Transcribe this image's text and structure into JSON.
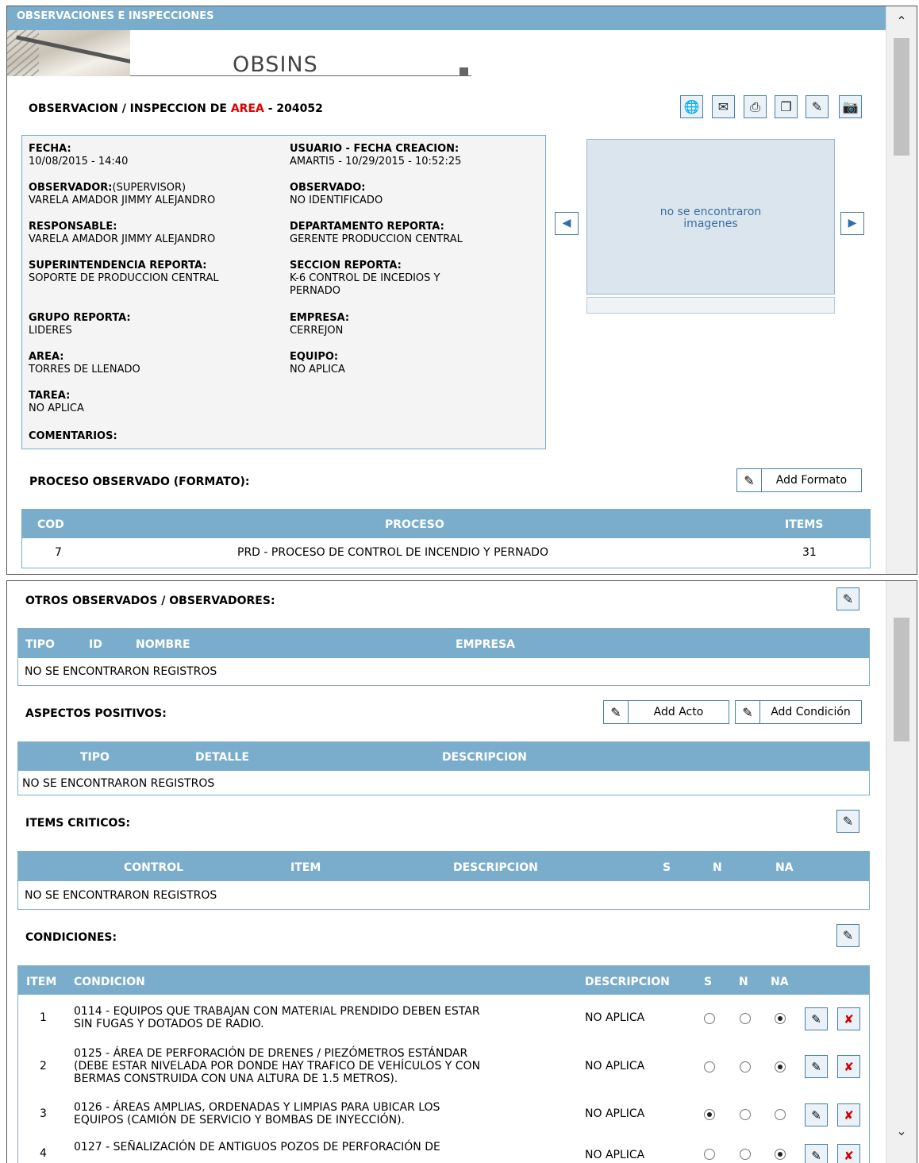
{
  "header": {
    "title": "OBSERVACIONES E INSPECCIONES",
    "banner": "OBSINS"
  },
  "record": {
    "prefix": "OBSERVACION / INSPECCION DE",
    "type": "AREA",
    "sep": " - ",
    "id": "204052"
  },
  "toolbar": [
    "globe-icon",
    "mail-icon",
    "print-icon",
    "copy-icon",
    "edit-icon",
    "camera-icon"
  ],
  "fields": {
    "fecha": {
      "label": "FECHA:",
      "value": "10/08/2015 - 14:40"
    },
    "usuario": {
      "label": "USUARIO - FECHA CREACION:",
      "value": "AMARTI5 - 10/29/2015 - 10:52:25"
    },
    "observador": {
      "label": "OBSERVADOR:",
      "sub": "(SUPERVISOR)",
      "value": "VARELA AMADOR JIMMY ALEJANDRO"
    },
    "observado": {
      "label": "OBSERVADO:",
      "value": "NO IDENTIFICADO"
    },
    "responsable": {
      "label": "RESPONSABLE:",
      "value": "VARELA AMADOR JIMMY ALEJANDRO"
    },
    "departamento": {
      "label": "DEPARTAMENTO REPORTA:",
      "value": "GERENTE PRODUCCION CENTRAL"
    },
    "superintendencia": {
      "label": "SUPERINTENDENCIA REPORTA:",
      "value": "SOPORTE DE PRODUCCION CENTRAL"
    },
    "seccion": {
      "label": "SECCION REPORTA:",
      "value1": "K-6 CONTROL DE INCEDIOS Y",
      "value2": "PERNADO"
    },
    "grupo": {
      "label": "GRUPO REPORTA:",
      "value": "LIDERES"
    },
    "empresa": {
      "label": "EMPRESA:",
      "value": "CERREJON"
    },
    "area": {
      "label": "AREA:",
      "value": "TORRES DE LLENADO"
    },
    "equipo": {
      "label": "EQUIPO:",
      "value": "NO APLICA"
    },
    "tarea": {
      "label": "TAREA:",
      "value": "NO APLICA"
    },
    "comentarios": {
      "label": "COMENTARIOS:"
    }
  },
  "images": {
    "line1": "no se encontraron",
    "line2": "imagenes"
  },
  "proceso": {
    "title": "PROCESO OBSERVADO (FORMATO):",
    "add_label": "Add Formato",
    "headers": {
      "cod": "COD",
      "proceso": "PROCESO",
      "items": "ITEMS"
    },
    "row": {
      "cod": "7",
      "proceso": "PRD - PROCESO DE CONTROL DE INCENDIO Y PERNADO",
      "items": "31"
    }
  },
  "otros": {
    "title": "OTROS OBSERVADOS / OBSERVADORES:",
    "headers": {
      "tipo": "TIPO",
      "id": "ID",
      "nombre": "NOMBRE",
      "empresa": "EMPRESA"
    },
    "empty": "NO SE ENCONTRARON REGISTROS"
  },
  "aspectos": {
    "title": "ASPECTOS POSITIVOS:",
    "add_acto": "Add Acto",
    "add_condicion": "Add Condición",
    "headers": {
      "tipo": "TIPO",
      "detalle": "DETALLE",
      "descripcion": "DESCRIPCION"
    },
    "empty": "NO SE ENCONTRARON REGISTROS"
  },
  "criticos": {
    "title": "ITEMS CRITICOS:",
    "headers": {
      "control": "CONTROL",
      "item": "ITEM",
      "descripcion": "DESCRIPCION",
      "s": "S",
      "n": "N",
      "na": "NA"
    },
    "empty": "NO SE ENCONTRARON REGISTROS"
  },
  "condiciones": {
    "title": "CONDICIONES:",
    "headers": {
      "item": "ITEM",
      "condicion": "CONDICION",
      "descripcion": "DESCRIPCION",
      "s": "S",
      "n": "N",
      "na": "NA"
    },
    "rows": [
      {
        "item": "1",
        "lines": [
          "0114 - EQUIPOS QUE TRABAJAN CON MATERIAL PRENDIDO DEBEN ESTAR",
          "SIN FUGAS Y DOTADOS DE RADIO."
        ],
        "descripcion": "NO APLICA",
        "selected": "na"
      },
      {
        "item": "2",
        "lines": [
          "0125 - ÁREA DE PERFORACIÓN DE DRENES / PIEZÓMETROS ESTÁNDAR",
          "(DEBE ESTAR NIVELADA POR DONDE HAY TRAFICO DE VEHÍCULOS Y CON",
          "BERMAS CONSTRUIDA CON UNA ALTURA DE 1.5 METROS)."
        ],
        "descripcion": "NO APLICA",
        "selected": "na"
      },
      {
        "item": "3",
        "lines": [
          "0126 - ÁREAS AMPLIAS, ORDENADAS Y LIMPIAS PARA UBICAR LOS",
          "EQUIPOS (CAMIÓN DE SERVICIO Y BOMBAS DE INYECCIÓN)."
        ],
        "descripcion": "NO APLICA",
        "selected": "s"
      },
      {
        "item": "4",
        "lines": [
          "0127 - SEÑALIZACIÓN DE ANTIGUOS POZOS DE PERFORACIÓN DE"
        ],
        "descripcion": "NO APLICA",
        "selected": "na"
      }
    ]
  },
  "colors": {
    "header": "#7aadcc",
    "accent_red": "#e00000",
    "info_bg": "#f4f4f4"
  }
}
